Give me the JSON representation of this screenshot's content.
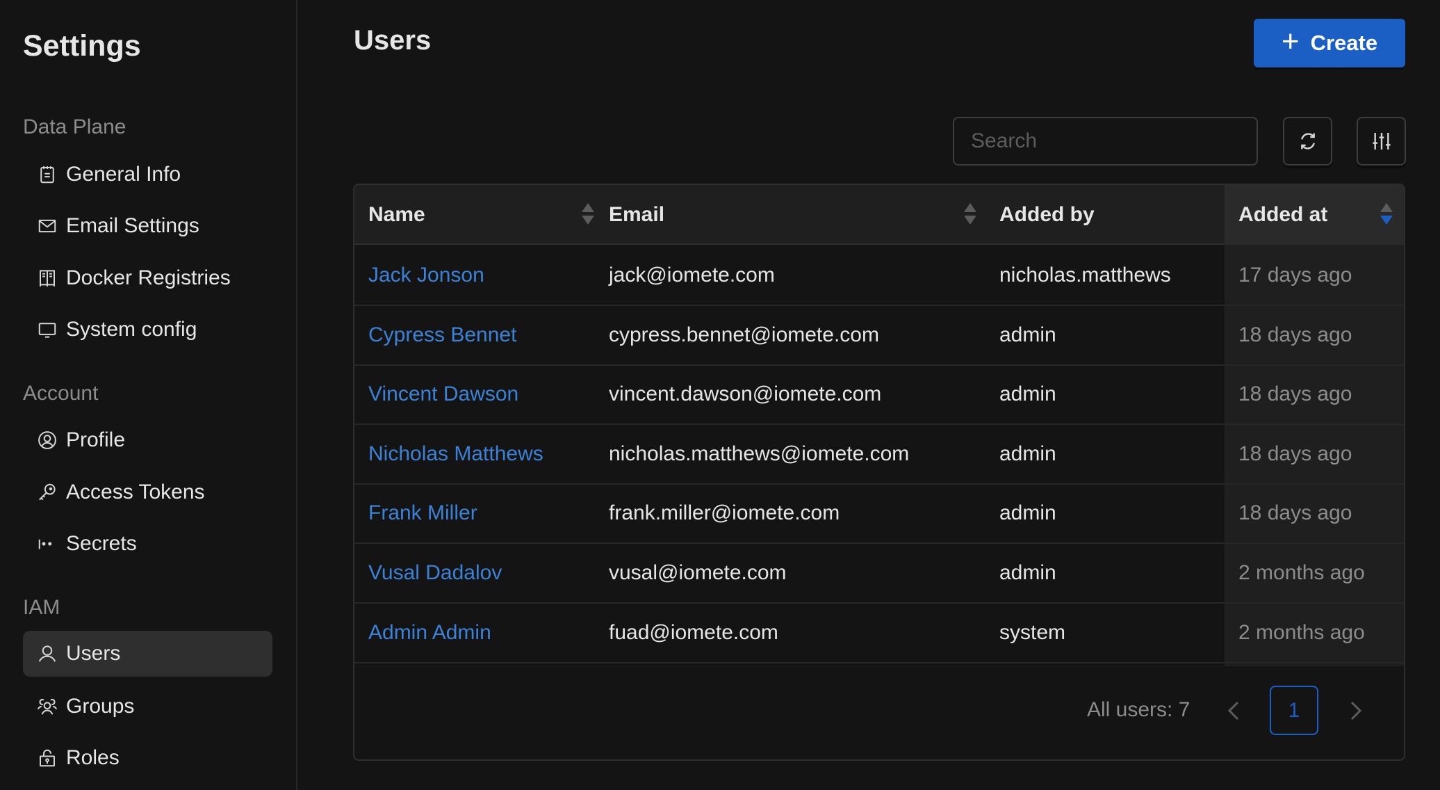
{
  "sidebar": {
    "title": "Settings",
    "sections": [
      {
        "label": "Data Plane",
        "items": [
          {
            "label": "General Info",
            "icon": "notepad-icon"
          },
          {
            "label": "Email Settings",
            "icon": "envelope-icon"
          },
          {
            "label": "Docker Registries",
            "icon": "registry-icon"
          },
          {
            "label": "System config",
            "icon": "monitor-icon"
          }
        ]
      },
      {
        "label": "Account",
        "items": [
          {
            "label": "Profile",
            "icon": "user-circle-icon"
          },
          {
            "label": "Access Tokens",
            "icon": "key-icon"
          },
          {
            "label": "Secrets",
            "icon": "password-icon"
          }
        ]
      },
      {
        "label": "IAM",
        "items": [
          {
            "label": "Users",
            "icon": "user-icon",
            "active": true
          },
          {
            "label": "Groups",
            "icon": "users-group-icon"
          },
          {
            "label": "Roles",
            "icon": "lock-icon"
          }
        ]
      }
    ]
  },
  "header": {
    "title": "Users",
    "create_label": "Create",
    "create_icon": "plus-icon"
  },
  "toolbar": {
    "search_placeholder": "Search",
    "search_value": "",
    "refresh_icon": "refresh-icon",
    "columns_icon": "sliders-icon"
  },
  "table": {
    "columns": [
      {
        "label": "Name",
        "sortable": true,
        "sort": "none"
      },
      {
        "label": "Email",
        "sortable": true,
        "sort": "none"
      },
      {
        "label": "Added by",
        "sortable": false
      },
      {
        "label": "Added at",
        "sortable": true,
        "sort": "descending"
      }
    ],
    "rows": [
      {
        "name": "Jack Jonson",
        "email": "jack@iomete.com",
        "added_by": "nicholas.matthews",
        "added_at": "17 days ago"
      },
      {
        "name": "Cypress Bennet",
        "email": "cypress.bennet@iomete.com",
        "added_by": "admin",
        "added_at": "18 days ago"
      },
      {
        "name": "Vincent Dawson",
        "email": "vincent.dawson@iomete.com",
        "added_by": "admin",
        "added_at": "18 days ago"
      },
      {
        "name": "Nicholas Matthews",
        "email": "nicholas.matthews@iomete.com",
        "added_by": "admin",
        "added_at": "18 days ago"
      },
      {
        "name": "Frank Miller",
        "email": "frank.miller@iomete.com",
        "added_by": "admin",
        "added_at": "18 days ago"
      },
      {
        "name": "Vusal Dadalov",
        "email": "vusal@iomete.com",
        "added_by": "admin",
        "added_at": "2 months ago"
      },
      {
        "name": "Admin Admin",
        "email": "fuad@iomete.com",
        "added_by": "system",
        "added_at": "2 months ago"
      }
    ]
  },
  "pagination": {
    "total_label": "All users: 7",
    "current_page": "1",
    "prev_icon": "chevron-left-icon",
    "next_icon": "chevron-right-icon"
  },
  "colors": {
    "accent": "#1b5fc4",
    "link": "#3b82d6",
    "background": "#141414"
  }
}
